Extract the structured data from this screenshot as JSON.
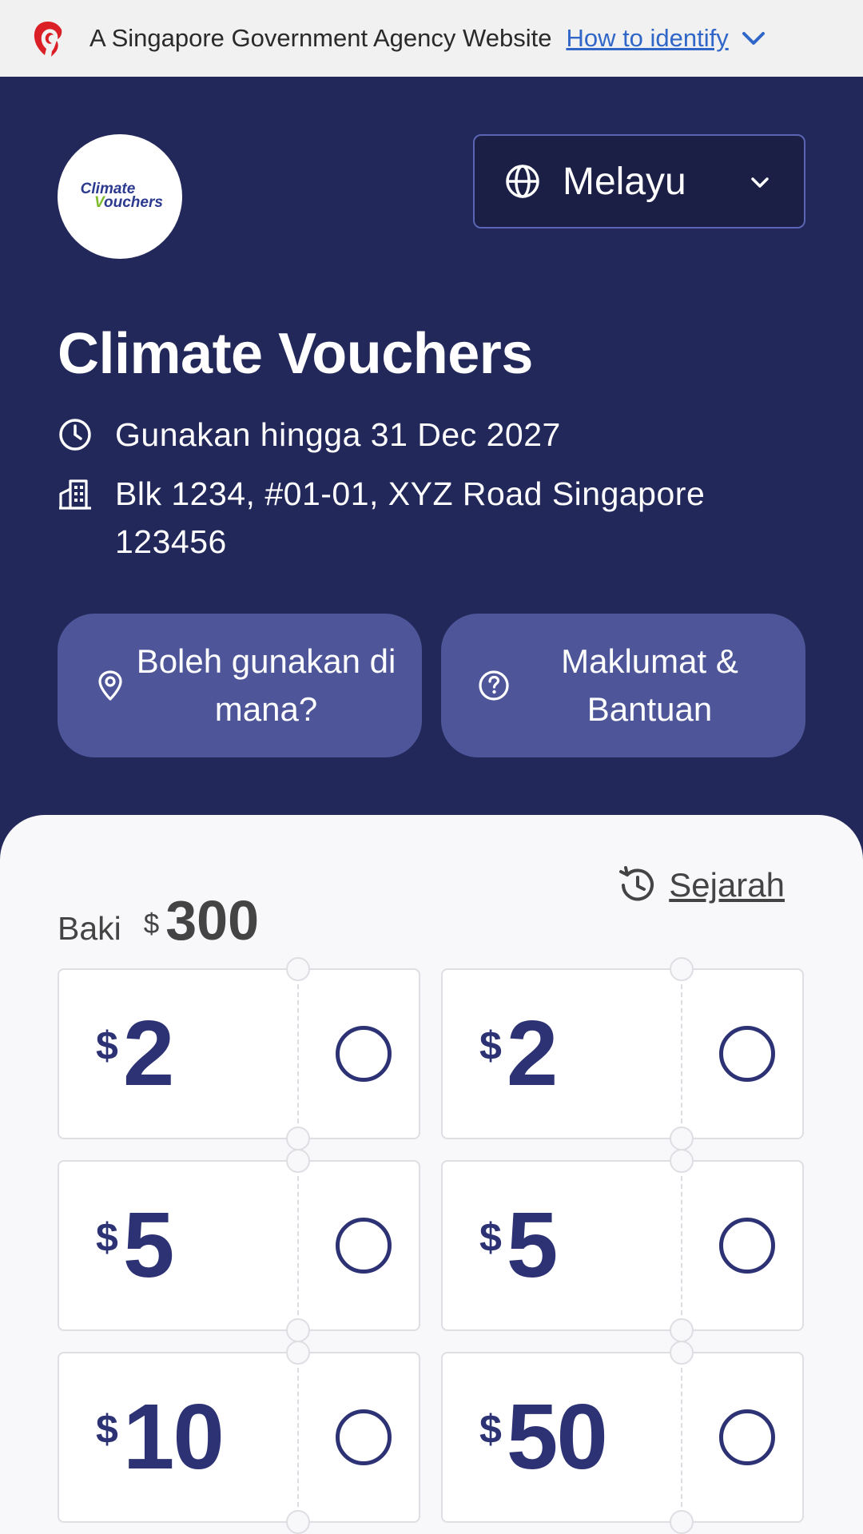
{
  "masthead": {
    "text": "A Singapore Government Agency Website",
    "link": "How to identify"
  },
  "logo": {
    "line1": "Climate",
    "line2_first": "V",
    "line2_rest": "ouchers"
  },
  "language": {
    "selected": "Melayu"
  },
  "header": {
    "title": "Climate Vouchers",
    "expiry": "Gunakan hingga 31 Dec 2027",
    "address": "Blk 1234, #01-01, XYZ Road Singapore 123456"
  },
  "actions": {
    "where_label": "Boleh gunakan di mana?",
    "help_label": "Maklumat & Bantuan"
  },
  "balance": {
    "label": "Baki",
    "currency": "$",
    "amount": "300",
    "history_label": "Sejarah"
  },
  "vouchers": [
    {
      "currency": "$",
      "value": "2"
    },
    {
      "currency": "$",
      "value": "2"
    },
    {
      "currency": "$",
      "value": "5"
    },
    {
      "currency": "$",
      "value": "5"
    },
    {
      "currency": "$",
      "value": "10"
    },
    {
      "currency": "$",
      "value": "50"
    }
  ],
  "colors": {
    "hero_bg": "#23285a",
    "pill_bg": "#4e5699",
    "voucher_text": "#2c3274",
    "link": "#2f66c8",
    "lion": "#db1f26"
  }
}
